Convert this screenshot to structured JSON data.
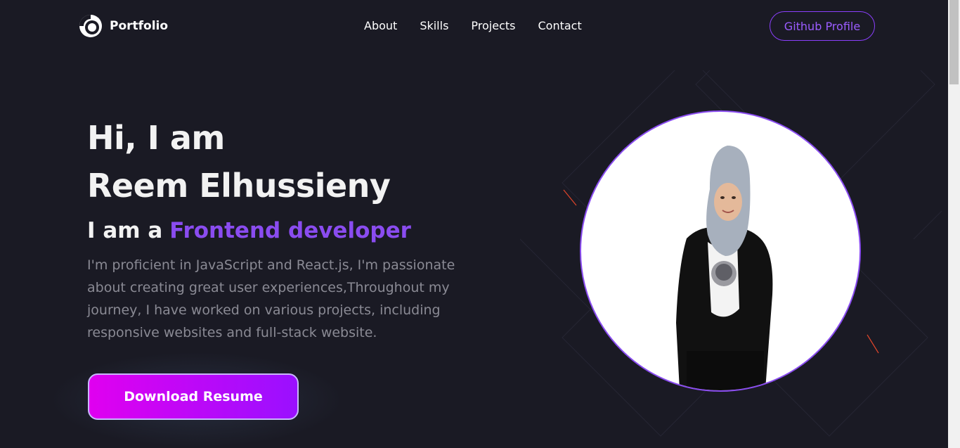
{
  "nav": {
    "logo_text": "Portfolio",
    "links": [
      "About",
      "Skills",
      "Projects",
      "Contact"
    ],
    "github_label": "Github Profile"
  },
  "hero": {
    "greeting": "Hi, I am",
    "name": "Reem Elhussieny",
    "intro": "I am a",
    "role": "Frontend developer",
    "bio": "I'm proficient in JavaScript and React.js, I'm passionate about creating great user experiences,Throughout my journey, I have worked on various projects, including responsive websites and full-stack website.",
    "resume_label": "Download Resume"
  },
  "icons": {
    "logo": "logo-ring-icon"
  },
  "colors": {
    "background": "#1a1a24",
    "accent": "#8a4cf0",
    "button_gradient_start": "#e000f0",
    "button_gradient_end": "#9a10ff"
  }
}
